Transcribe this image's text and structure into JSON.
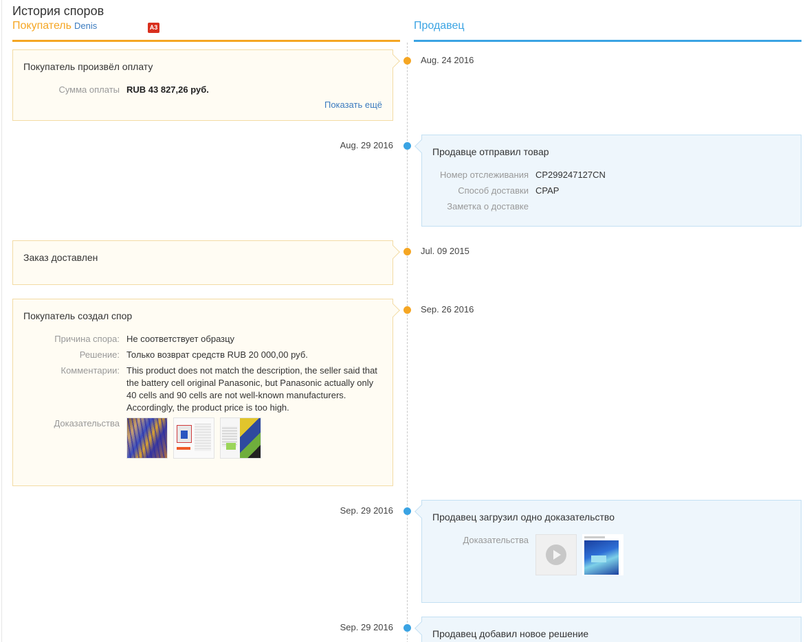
{
  "header": {
    "title": "История споров",
    "buyer_label": "Покупатель",
    "buyer_name": "Denis",
    "buyer_badge": "A3",
    "seller_label": "Продавец"
  },
  "colors": {
    "buyer": "#f5a623",
    "seller": "#3aa3e3",
    "link": "#3b7bbf",
    "badge": "#d9301e"
  },
  "events": [
    {
      "date": "Aug. 24 2016",
      "title": "Покупатель произвёл оплату",
      "fields": [
        {
          "label": "Сумма оплаты",
          "value": "RUB 43 827,26 руб."
        }
      ],
      "link": "Показать ещё"
    },
    {
      "date": "Aug. 29 2016",
      "title": "Продавце отправил товар",
      "fields": [
        {
          "label": "Номер отслеживания",
          "value": "CP299247127CN"
        },
        {
          "label": "Способ доставки",
          "value": "CPAP"
        },
        {
          "label": "Заметка о доставке",
          "value": ""
        }
      ]
    },
    {
      "date": "Jul. 09 2015",
      "title": "Заказ доставлен"
    },
    {
      "date": "Sep. 26 2016",
      "title": "Покупатель создал спор",
      "fields": [
        {
          "label": "Причина спора:",
          "value": "Не соответствует образцу"
        },
        {
          "label": "Решение:",
          "value": "Только возврат средств RUB 20 000,00 руб."
        },
        {
          "label": "Комментарии:",
          "value": "This product does not match the description, the seller said that the battery cell original Panasonic, but Panasonic actually only 40 cells and 90 cells are not well-known manufacturers. Accordingly, the product price is too high."
        },
        {
          "label": "Доказательства",
          "value": ""
        }
      ]
    },
    {
      "date": "Sep. 29 2016",
      "title": "Продавец загрузил одно доказательство",
      "fields": [
        {
          "label": "Доказательства",
          "value": ""
        }
      ]
    },
    {
      "date": "Sep. 29 2016",
      "title": "Продавец добавил новое решение"
    }
  ]
}
